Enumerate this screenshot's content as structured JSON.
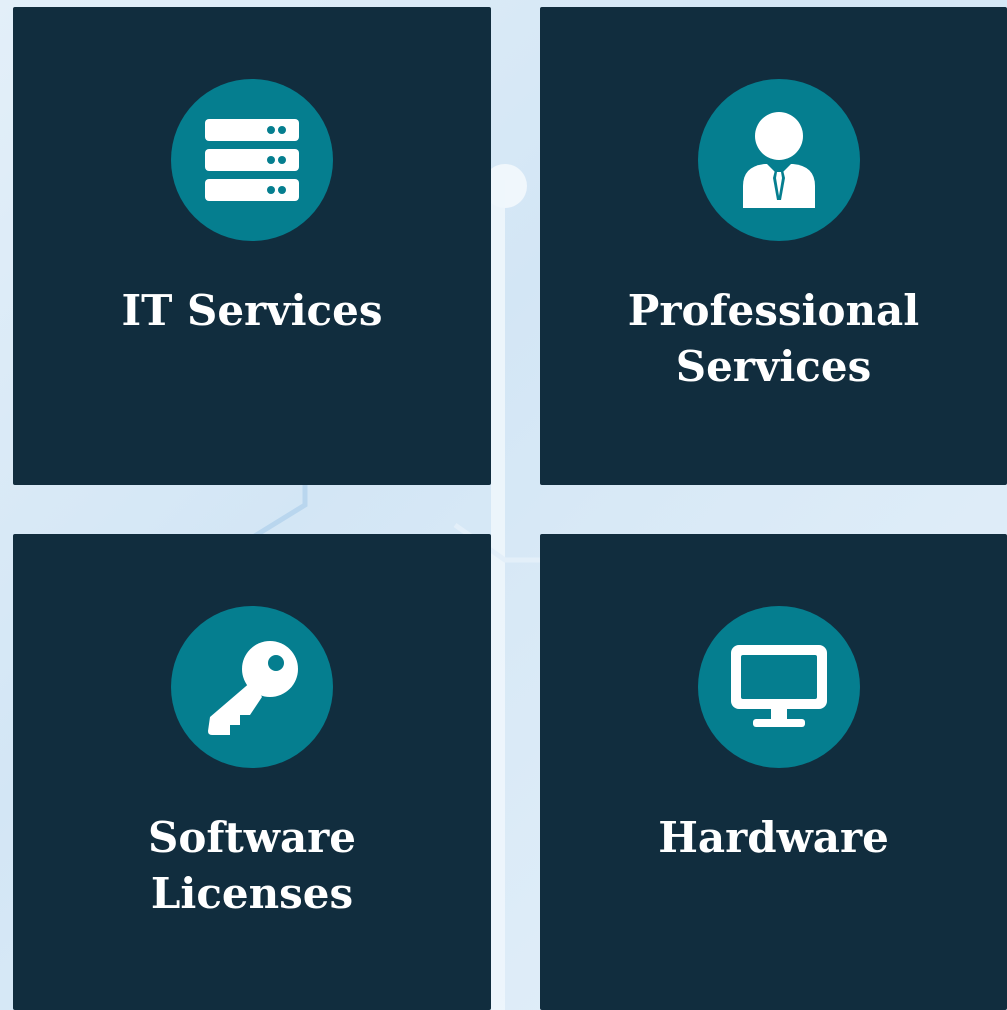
{
  "cards": [
    {
      "title": "IT Services",
      "icon": "server-icon"
    },
    {
      "title": "Professional\nServices",
      "icon": "businessman-icon"
    },
    {
      "title": "Software\nLicenses",
      "icon": "key-icon"
    },
    {
      "title": "Hardware",
      "icon": "monitor-icon"
    }
  ],
  "colors": {
    "card_background": "#112d3e",
    "icon_circle": "#057e8f",
    "text": "#ffffff",
    "page_background": "#dbeaf6"
  }
}
